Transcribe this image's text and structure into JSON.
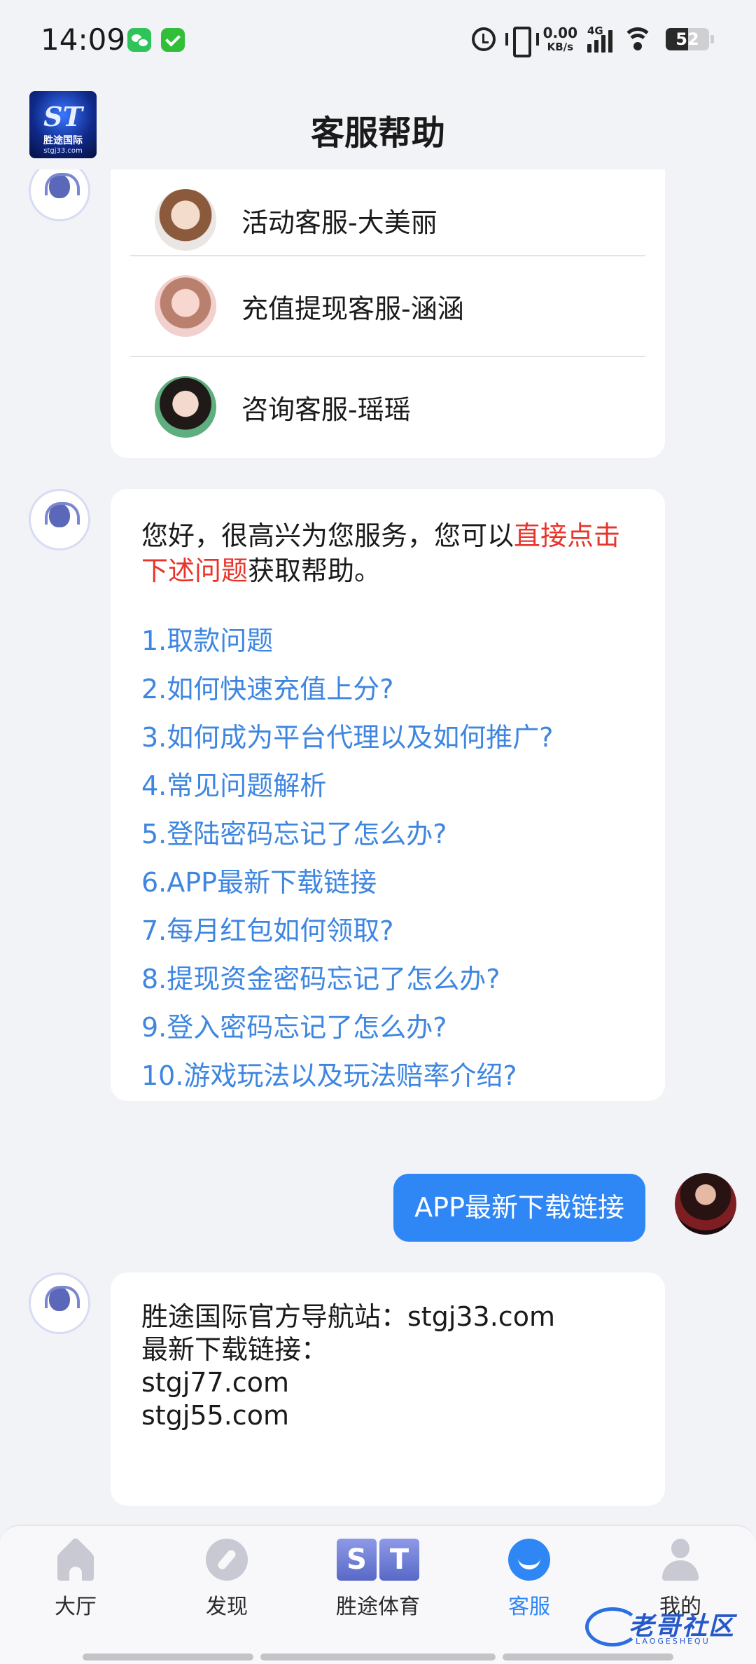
{
  "status_bar": {
    "time": "14:09",
    "net_speed_value": "0.00",
    "net_speed_unit": "KB/s",
    "network_type": "4G",
    "battery_level": "52",
    "battery_fraction": 0.52
  },
  "header": {
    "title": "客服帮助",
    "logo": {
      "mark": "ST",
      "name": "胜途国际",
      "url": "stgj33.com"
    }
  },
  "agents": [
    {
      "name": "活动客服-大美丽"
    },
    {
      "name": "充值提现客服-涵涵"
    },
    {
      "name": "咨询客服-瑶瑶"
    }
  ],
  "welcome": {
    "part1": "您好，很高兴为您服务，您可以",
    "highlight": "直接点击下述问题",
    "part2": "获取帮助。",
    "faq": [
      "1.取款问题",
      "2.如何快速充值上分?",
      "3.如何成为平台代理以及如何推广?",
      "4.常见问题解析",
      "5.登陆密码忘记了怎么办?",
      "6.APP最新下载链接",
      "7.每月红包如何领取?",
      "8.提现资金密码忘记了怎么办?",
      "9.登入密码忘记了怎么办?",
      "10.游戏玩法以及玩法赔率介绍?"
    ]
  },
  "user_message": "APP最新下载链接",
  "answer": {
    "lines": [
      "胜途国际官方导航站：stgj33.com",
      "最新下载链接：",
      "stgj77.com",
      "stgj55.com"
    ]
  },
  "bottom_nav": {
    "items": [
      {
        "label": "大厅",
        "icon": "home-icon"
      },
      {
        "label": "发现",
        "icon": "compass-icon"
      },
      {
        "label": "胜途体育",
        "icon": "st-sports-icon",
        "icon_letters": [
          "S",
          "T"
        ]
      },
      {
        "label": "客服",
        "icon": "customer-service-icon",
        "active": true
      },
      {
        "label": "我的",
        "icon": "user-icon"
      }
    ]
  },
  "watermark": {
    "text": "老哥社区",
    "sub": "LAOGESHEQU"
  },
  "colors": {
    "accent": "#2f86f5",
    "link": "#3e86e0",
    "highlight_red": "#e8352b",
    "background": "#f2f3f7"
  }
}
